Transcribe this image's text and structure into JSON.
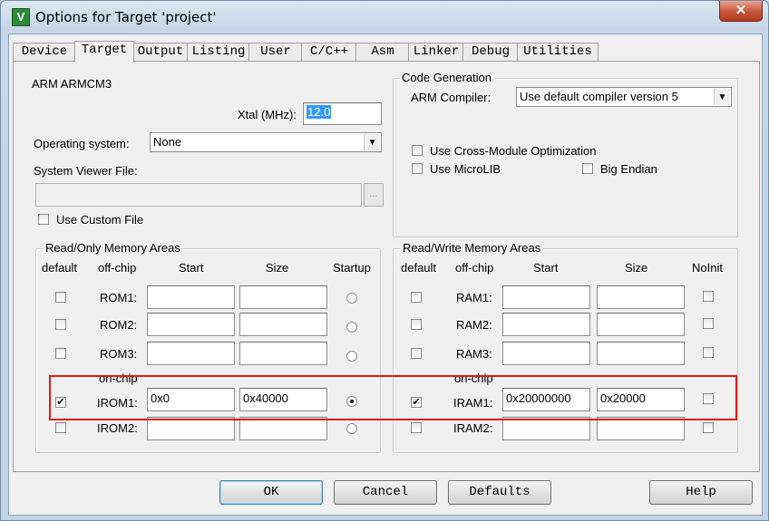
{
  "window": {
    "title": "Options for Target 'project'",
    "close_glyph": "✕",
    "icon_letter": "V"
  },
  "tabs": [
    {
      "label": "Device",
      "active": false
    },
    {
      "label": "Target",
      "active": true
    },
    {
      "label": "Output",
      "active": false
    },
    {
      "label": "Listing",
      "active": false
    },
    {
      "label": "User",
      "active": false
    },
    {
      "label": "C/C++",
      "active": false
    },
    {
      "label": "Asm",
      "active": false
    },
    {
      "label": "Linker",
      "active": false
    },
    {
      "label": "Debug",
      "active": false
    },
    {
      "label": "Utilities",
      "active": false
    }
  ],
  "target": {
    "device_name": "ARM ARMCM3",
    "xtal_label": "Xtal (MHz):",
    "xtal_value": "12.0",
    "os_label": "Operating system:",
    "os_value": "None",
    "sysviewer_label": "System Viewer File:",
    "sysviewer_value": "",
    "browse_label": "...",
    "use_custom_file_label": "Use Custom File",
    "use_custom_file_checked": false
  },
  "code_generation": {
    "title": "Code Generation",
    "compiler_label": "ARM Compiler:",
    "compiler_value": "Use default compiler version 5",
    "cross_module_label": "Use Cross-Module Optimization",
    "cross_module_checked": false,
    "microlib_label": "Use MicroLIB",
    "microlib_checked": false,
    "big_endian_label": "Big Endian",
    "big_endian_checked": false
  },
  "rom_area": {
    "title": "Read/Only Memory Areas",
    "headers": {
      "default": "default",
      "offchip": "off-chip",
      "start": "Start",
      "size": "Size",
      "startup": "Startup"
    },
    "onchip_label": "on-chip",
    "rows": [
      {
        "name": "ROM1:",
        "start": "",
        "size": "",
        "default": false,
        "startup": false
      },
      {
        "name": "ROM2:",
        "start": "",
        "size": "",
        "default": false,
        "startup": false
      },
      {
        "name": "ROM3:",
        "start": "",
        "size": "",
        "default": false,
        "startup": false
      },
      {
        "name": "IROM1:",
        "start": "0x0",
        "size": "0x40000",
        "default": true,
        "startup": true
      },
      {
        "name": "IROM2:",
        "start": "",
        "size": "",
        "default": false,
        "startup": false
      }
    ]
  },
  "ram_area": {
    "title": "Read/Write Memory Areas",
    "headers": {
      "default": "default",
      "offchip": "off-chip",
      "start": "Start",
      "size": "Size",
      "noinit": "NoInit"
    },
    "onchip_label": "on-chip",
    "rows": [
      {
        "name": "RAM1:",
        "start": "",
        "size": "",
        "default": false,
        "noinit": false
      },
      {
        "name": "RAM2:",
        "start": "",
        "size": "",
        "default": false,
        "noinit": false
      },
      {
        "name": "RAM3:",
        "start": "",
        "size": "",
        "default": false,
        "noinit": false
      },
      {
        "name": "IRAM1:",
        "start": "0x20000000",
        "size": "0x20000",
        "default": true,
        "noinit": false
      },
      {
        "name": "IRAM2:",
        "start": "",
        "size": "",
        "default": false,
        "noinit": false
      }
    ]
  },
  "buttons": {
    "ok": "OK",
    "cancel": "Cancel",
    "defaults": "Defaults",
    "help": "Help"
  },
  "colors": {
    "highlight": "#e01818",
    "selection": "#3399ff"
  }
}
